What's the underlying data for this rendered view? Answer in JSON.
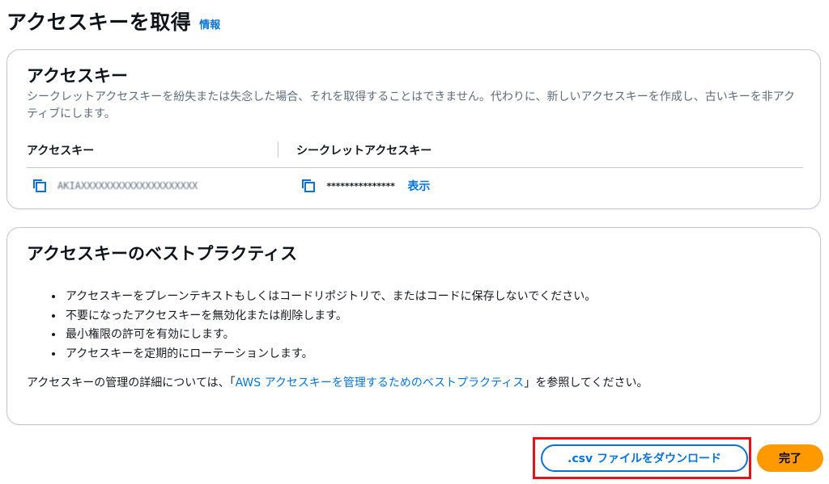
{
  "header": {
    "title": "アクセスキーを取得",
    "info_link": "情報"
  },
  "access_key_card": {
    "title": "アクセスキー",
    "description": "シークレットアクセスキーを紛失または失念した場合、それを取得することはできません。代わりに、新しいアクセスキーを作成し、古いキーを非アクティブにします。",
    "columns": [
      "アクセスキー",
      "シークレットアクセスキー"
    ],
    "access_key_value": "AKIAXXXXXXXXXXXXXXXXXXXX",
    "secret_key_masked": "***************",
    "show_link": "表示",
    "icons": [
      "copy-icon",
      "copy-icon"
    ]
  },
  "best_practices_card": {
    "title": "アクセスキーのベストプラクティス",
    "items": [
      "アクセスキーをプレーンテキストもしくはコードリポジトリで、またはコードに保存しないでください。",
      "不要になったアクセスキーを無効化または削除します。",
      "最小権限の許可を有効にします。",
      "アクセスキーを定期的にローテーションします。"
    ],
    "manage_prefix": "アクセスキーの管理の詳細については、「",
    "manage_link": "AWS アクセスキーを管理するためのベストプラクティス",
    "manage_suffix": "」を参照してください。"
  },
  "actions": {
    "download_label": ".csv ファイルをダウンロード",
    "done_label": "完了"
  },
  "colors": {
    "link": "#0972d3",
    "primary_button": "#ff9900",
    "highlight": "#e0141b",
    "border": "#c6c6cd"
  }
}
